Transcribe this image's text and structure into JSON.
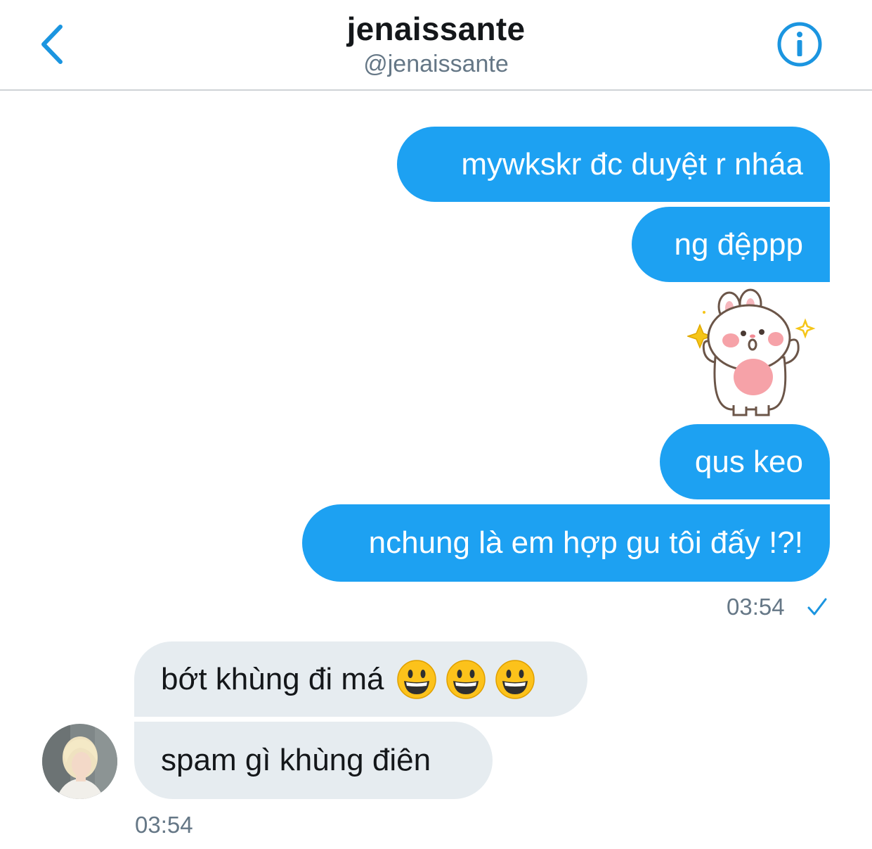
{
  "header": {
    "title": "jenaissante",
    "handle": "@jenaissante"
  },
  "colors": {
    "accent": "#1da1f2",
    "link": "#1b95e0",
    "incoming_bubble": "#e6ecf0",
    "meta_text": "#657786"
  },
  "outgoing": {
    "messages": [
      "mywkskr đc duyệt r nháa",
      "ng đệppp",
      "qus keo",
      "nchung là em hợp gu tôi đấy !?!"
    ],
    "sticker": "bunny-sticker",
    "timestamp": "03:54",
    "status_icon": "check-icon"
  },
  "incoming": {
    "messages": [
      "bớt khùng đi má",
      "spam gì khùng điên"
    ],
    "emoji": "grinning-face",
    "timestamp": "03:54"
  }
}
